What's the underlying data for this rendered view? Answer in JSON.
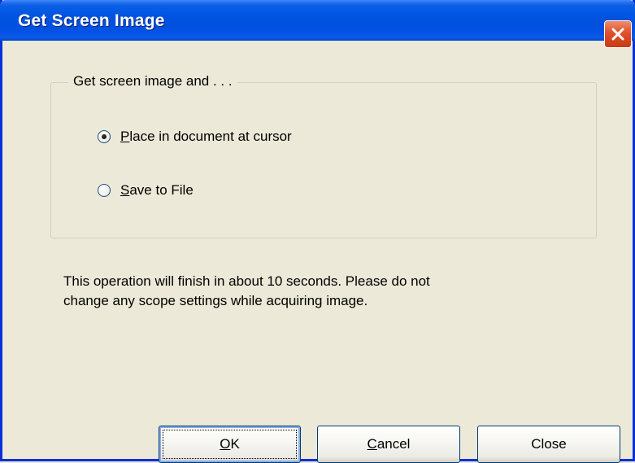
{
  "window": {
    "title": "Get Screen Image",
    "close_icon": "close-x-icon"
  },
  "group": {
    "legend": "Get screen image and . . .",
    "options": [
      {
        "mnemonic": "P",
        "rest": "lace in document at cursor",
        "checked": true
      },
      {
        "mnemonic": "S",
        "rest": "ave to File",
        "checked": false
      }
    ]
  },
  "message": {
    "line1": "This operation will finish in about 10 seconds. Please do not",
    "line2": "change any scope settings while acquiring image."
  },
  "buttons": {
    "ok": {
      "mnemonic": "O",
      "rest": "K"
    },
    "cancel": {
      "mnemonic": "C",
      "rest": "ancel"
    },
    "close": {
      "label": "Close"
    }
  },
  "colors": {
    "title_bar": "#0053E0",
    "window_face": "#ECE9D8",
    "close_button": "#E1502A"
  }
}
